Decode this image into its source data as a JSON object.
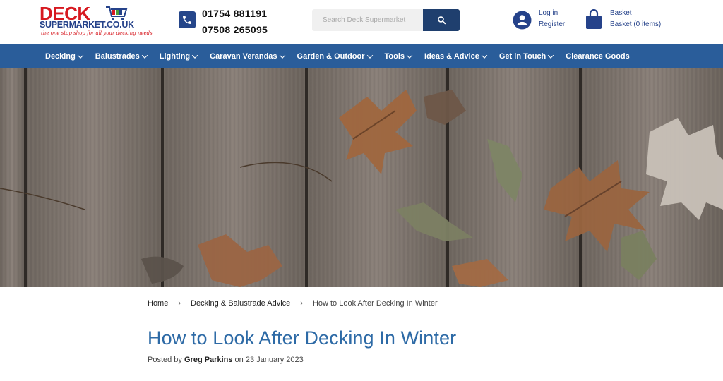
{
  "logo": {
    "brand_top": "DECK",
    "brand_bottom": "SUPERMARKET.CO.UK",
    "tagline": "the one stop shop for all your decking needs"
  },
  "contact": {
    "phone_1": "01754 881191",
    "phone_2": "07508 265095"
  },
  "search": {
    "placeholder": "Search Deck Supermarket"
  },
  "account": {
    "login_label": "Log in",
    "register_label": "Register"
  },
  "basket": {
    "title": "Basket",
    "status": "Basket (0 items)"
  },
  "nav": {
    "items": [
      {
        "label": "Decking",
        "has_dropdown": true
      },
      {
        "label": "Balustrades",
        "has_dropdown": true
      },
      {
        "label": "Lighting",
        "has_dropdown": true
      },
      {
        "label": "Caravan Verandas",
        "has_dropdown": true
      },
      {
        "label": "Garden & Outdoor",
        "has_dropdown": true
      },
      {
        "label": "Tools",
        "has_dropdown": true
      },
      {
        "label": "Ideas & Advice",
        "has_dropdown": true
      },
      {
        "label": "Get in Touch",
        "has_dropdown": true
      },
      {
        "label": "Clearance Goods",
        "has_dropdown": false
      }
    ]
  },
  "breadcrumb": {
    "home": "Home",
    "separator": "›",
    "category": "Decking & Balustrade Advice",
    "current": "How to Look After Decking In Winter"
  },
  "post": {
    "title": "How to Look After Decking In Winter",
    "meta_prefix": "Posted by ",
    "author": "Greg Parkins",
    "meta_on": " on ",
    "date": "23 January 2023"
  },
  "colors": {
    "brand_red": "#d71920",
    "brand_blue": "#25428a",
    "nav_bar": "#2a5d9a",
    "title_blue": "#2d6aa6",
    "search_button": "#1f3f6e"
  },
  "icons": {
    "phone": "phone-icon",
    "search": "search-icon",
    "account": "user-circle-icon",
    "basket": "shopping-bag-icon",
    "dropdown": "chevron-down-icon"
  }
}
